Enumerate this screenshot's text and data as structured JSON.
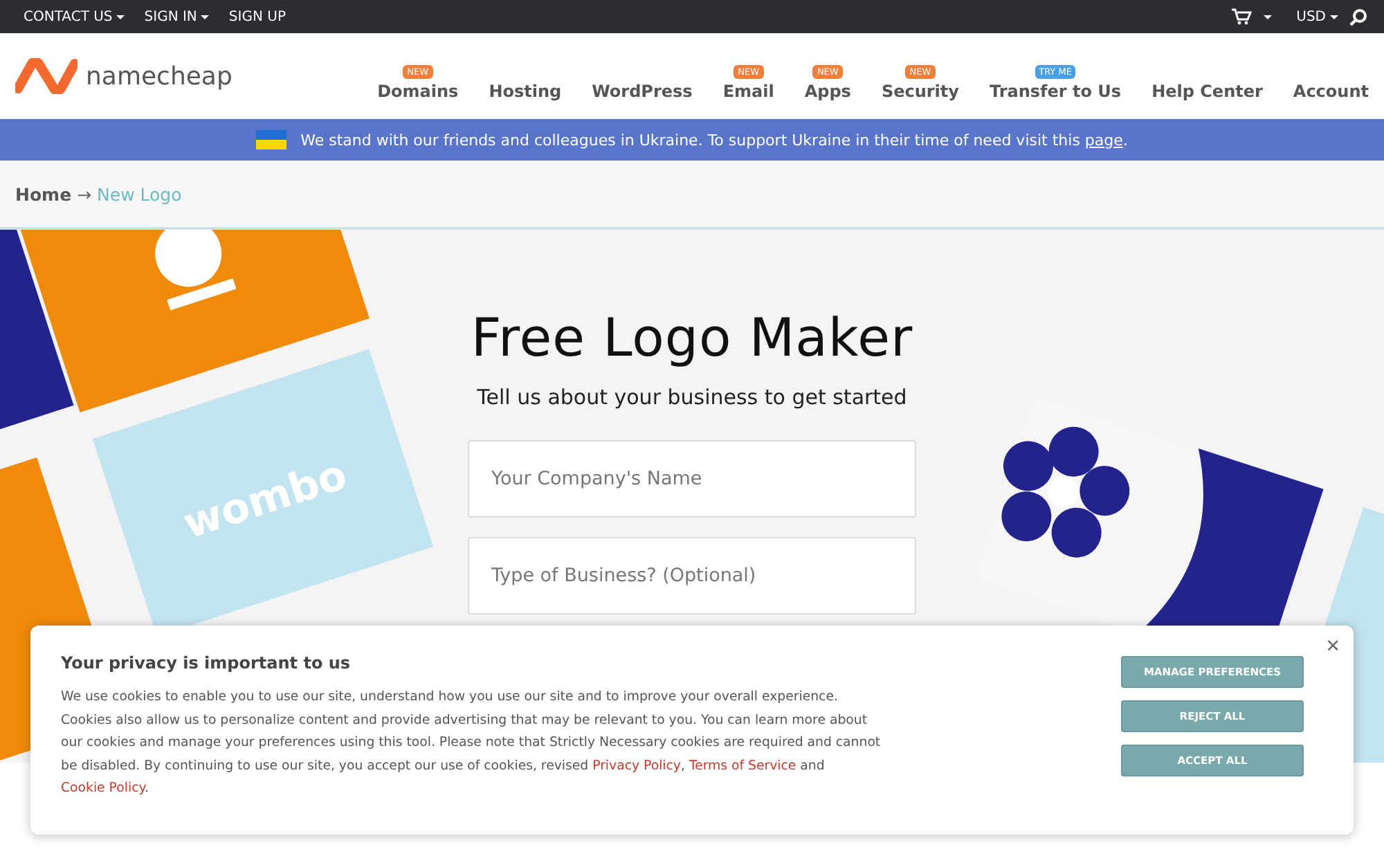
{
  "top_bar": {
    "left": [
      {
        "label": "CONTACT US",
        "caret": true
      },
      {
        "label": "SIGN IN",
        "caret": true
      },
      {
        "label": "SIGN UP",
        "caret": false
      }
    ],
    "currency": "USD"
  },
  "header": {
    "logo_text": "namecheap",
    "nav": [
      {
        "label": "Domains",
        "badge": "NEW",
        "color": "#f07f3c"
      },
      {
        "label": "Hosting"
      },
      {
        "label": "WordPress"
      },
      {
        "label": "Email",
        "badge": "NEW",
        "color": "#f07f3c"
      },
      {
        "label": "Apps",
        "badge": "NEW",
        "color": "#f07f3c"
      },
      {
        "label": "Security",
        "badge": "NEW",
        "color": "#f07f3c"
      },
      {
        "label": "Transfer to Us",
        "badge": "TRY ME",
        "color": "#4a9fe0"
      },
      {
        "label": "Help Center"
      },
      {
        "label": "Account"
      }
    ]
  },
  "notice": {
    "text": "We stand with our friends and colleagues in Ukraine. To support Ukraine in their time of need visit this",
    "link": "page",
    "end": "."
  },
  "breadcrumb": [
    {
      "label": "Home",
      "selected": false
    },
    {
      "label": "New Logo",
      "selected": true
    }
  ],
  "breadcrumb_separator": "→",
  "hero": {
    "title": "Free Logo Maker",
    "subtitle": "Tell us about your business to get started",
    "fields": [
      {
        "placeholder": "Your Company's Name"
      },
      {
        "placeholder": "Type of Business? (Optional)"
      }
    ],
    "card_text": "wombo"
  },
  "cookie_banner": {
    "title": "Your privacy is important to us",
    "body": "We use cookies to enable you to use our site, understand how you use our site and to improve your overall experience. Cookies also allow us to personalize content and provide advertising that may be relevant to you. You can learn more about our cookies and manage your preferences using this tool. Please note that Strictly Necessary cookies are required and cannot be disabled. By continuing to use our site, you accept our use of cookies, revised",
    "links": [
      "Privacy Policy",
      "Terms of Service",
      "Cookie Policy"
    ],
    "joiners": [
      ",",
      "and",
      "."
    ],
    "close": "×",
    "buttons": [
      "MANAGE PREFERENCES",
      "REJECT ALL",
      "ACCEPT ALL"
    ]
  }
}
